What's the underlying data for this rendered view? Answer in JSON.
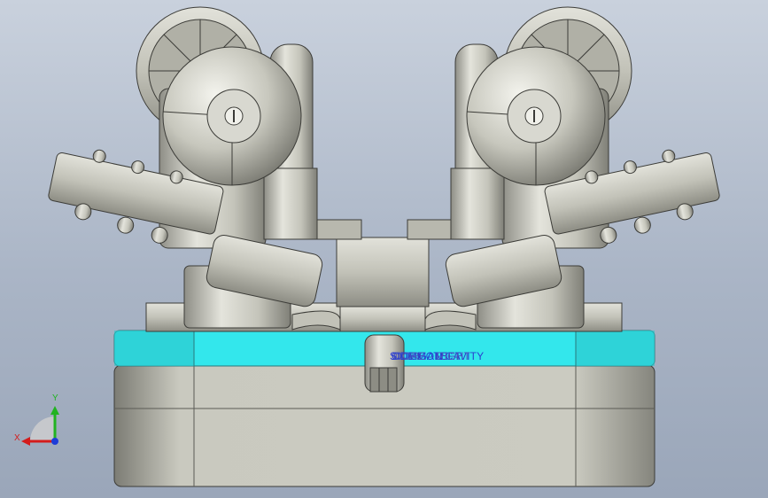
{
  "colors": {
    "background_top": "#c9d1dd",
    "background_bottom": "#9aa6b9",
    "cavity_plate": "#33e7ec",
    "metal": "#c6c6bc",
    "annotation_blue": "#1e2fd6",
    "axis_x": "#d41c1c",
    "axis_y": "#21b321",
    "axis_z": "#1e3cd8"
  },
  "annotation": {
    "layer1": "SIDE GATE",
    "layer2": "COMMON CAVITY",
    "layer3": "CORE - LEFT",
    "layer4": "CORE - RIGHT"
  },
  "triad": {
    "x_label": "X",
    "y_label": "Y"
  },
  "icons": {
    "triad": "axis-triad-icon"
  }
}
